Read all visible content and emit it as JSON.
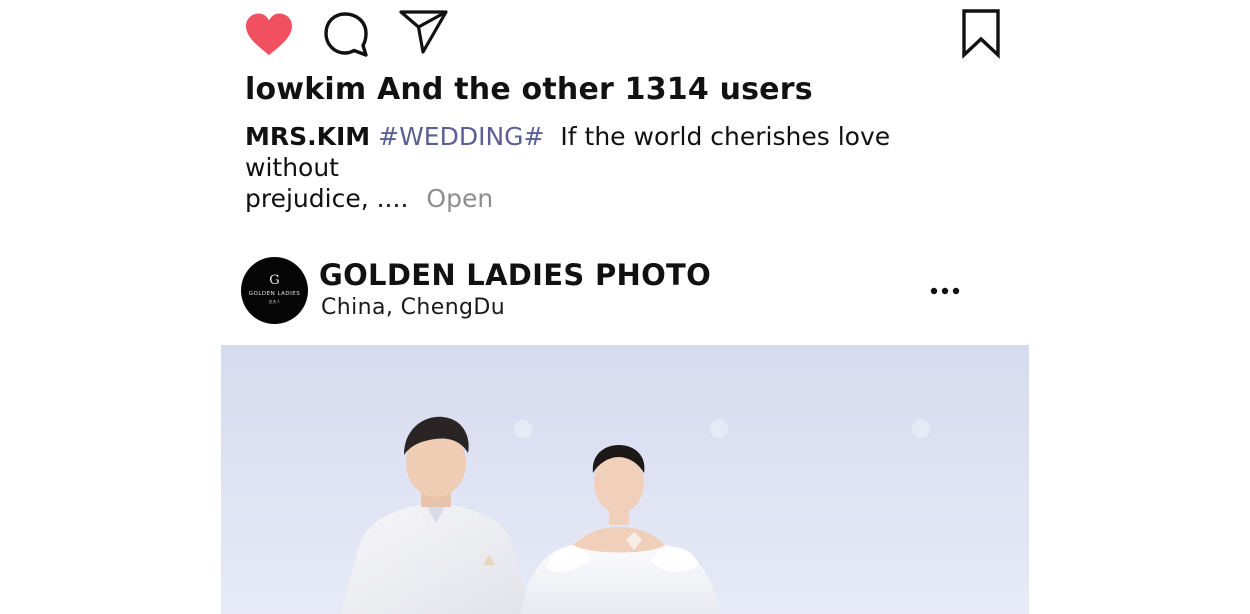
{
  "actions": {
    "like_icon": "heart-filled-icon",
    "comment_icon": "comment-bubble-icon",
    "share_icon": "send-icon",
    "bookmark_icon": "bookmark-icon",
    "like_color": "#f0505f"
  },
  "likes_text": "lowkim And the other 1314 users",
  "caption": {
    "author": "MRS.KIM",
    "hashtag": "#WEDDING#",
    "text_line1": "If the world cherishes love without",
    "text_line2": "prejudice, ....",
    "open_label": "Open"
  },
  "post": {
    "account_name": "GOLDEN LADIES PHOTO",
    "location_country": "China,",
    "location_city": "ChengDu",
    "more_icon": "more-dots-icon",
    "avatar": {
      "mark": "G",
      "text": "GOLDEN LADIES",
      "subtext": "金夫人"
    },
    "image_alt": "wedding couple photo",
    "hashtag_color": "#5c5f94",
    "open_color": "#8e8e8e"
  }
}
